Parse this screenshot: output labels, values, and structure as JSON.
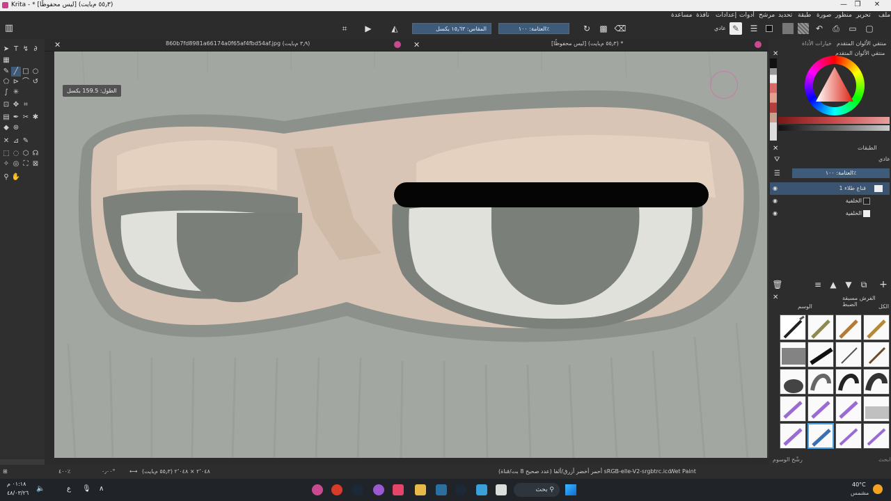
{
  "window": {
    "title": "Krita - * [ليس محفوظًا] (٥٥٫٣ م‌بايت)",
    "controls": [
      "—",
      "❐",
      "✕"
    ]
  },
  "menubar": {
    "items": [
      "ملف",
      "تحرير",
      "منظور",
      "صورة",
      "طبقة",
      "تحديد",
      "مرشح",
      "أدوات",
      "إعدادات",
      "نافذة",
      "مساعدة"
    ]
  },
  "toolbar": {
    "blend_mode": "عادي",
    "opacity_label": "العتامة: ١٠٠٪",
    "size_label": "المقاس: ١٥٫٦٣ بكسل"
  },
  "tabs": [
    {
      "label": "860b7fd8981a66174a0f65af4fbd54af.jpg (٣٫٩ م‌بايت)",
      "active": false
    },
    {
      "label": "[ليس محفوظًا] (٥٥٫٣ م‌بايت) *",
      "active": true
    }
  ],
  "canvas": {
    "measure_tooltip": "الطول: 159.5 بكسل"
  },
  "statusbar": {
    "zoom": "٤٠٠٪",
    "rotation": "٠٫٠٠°",
    "image_info": "٢٬٠٤٨ × ٢٬٠٤٨ (٥٥٫٣ م‌بايت)",
    "color_profile": "أحمر أخضر أزرق/ألفا (عدد صحيح 8 بت/قناة)  sRGB-elle-V2-srgbtrc.icc",
    "brush_preset": "Wet Paint"
  },
  "dockers": {
    "tab_tool_options": "خيارات الأداة",
    "tab_color_selector": "منتقي الألوان المتقدم",
    "color_selector_title": "منتقي الألوان المتقدم",
    "layers_title": "الطبقات",
    "layers_blend": "عادي",
    "layers_opacity": "العتامة: ١٠٠٪",
    "layers": [
      {
        "name": "قناع طلاء 1",
        "selected": true
      },
      {
        "name": "الخلفية",
        "selected": false
      },
      {
        "name": "الخلفية",
        "selected": false
      }
    ],
    "brush_presets_title": "الفرش مسبقة الضبط",
    "brush_tag_label": "الكل",
    "brush_tag_filter": "الوسم",
    "brush_search_placeholder": "ابحث",
    "brush_filter_checkbox": "رشّح الوسوم"
  },
  "taskbar": {
    "search_label": "بحث",
    "weather_temp": "40°C",
    "weather_desc": "مشمس",
    "time": "٠١:١٨ م",
    "date": "٤٨/٠٣/٢٦"
  },
  "colors": {
    "accent": "#3f5b7a",
    "selected_layer": "#3b5472",
    "canvas_bg": "#a2a6a0"
  }
}
